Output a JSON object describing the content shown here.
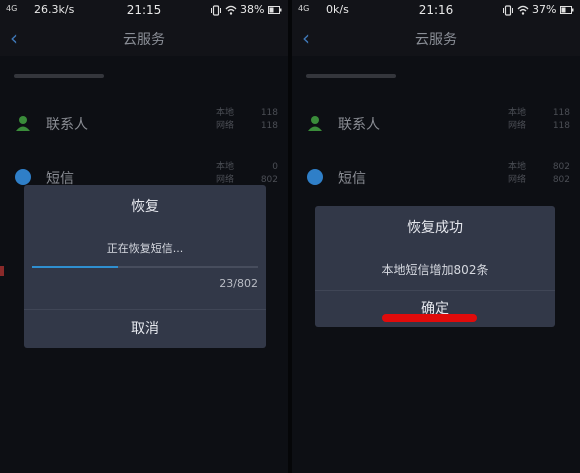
{
  "screens": [
    {
      "status": {
        "network": "4G",
        "speed": "26.3k/s",
        "time": "21:15",
        "battery": "38%"
      },
      "header": {
        "title": "云服务"
      },
      "rows": [
        {
          "label": "联系人",
          "local_label": "本地",
          "local_value": "118",
          "cloud_label": "网络",
          "cloud_value": "118"
        },
        {
          "label": "短信",
          "local_label": "本地",
          "local_value": "0",
          "cloud_label": "网络",
          "cloud_value": "802"
        }
      ],
      "dialog": {
        "title": "恢复",
        "message": "正在恢复短信...",
        "progress": 0.38,
        "count": "23/802",
        "button": "取消"
      }
    },
    {
      "status": {
        "network": "4G",
        "speed": "0k/s",
        "time": "21:16",
        "battery": "37%"
      },
      "header": {
        "title": "云服务"
      },
      "rows": [
        {
          "label": "联系人",
          "local_label": "本地",
          "local_value": "118",
          "cloud_label": "网络",
          "cloud_value": "118"
        },
        {
          "label": "短信",
          "local_label": "本地",
          "local_value": "802",
          "cloud_label": "网络",
          "cloud_value": "802"
        }
      ],
      "dialog": {
        "title": "恢复成功",
        "message": "本地短信增加802条",
        "button": "确定"
      }
    }
  ],
  "colors": {
    "accent": "#2f8fd0",
    "contacts_icon": "#3a8c3a",
    "sms_icon": "#2f7fc8",
    "annotation_red": "#e00b0b"
  }
}
